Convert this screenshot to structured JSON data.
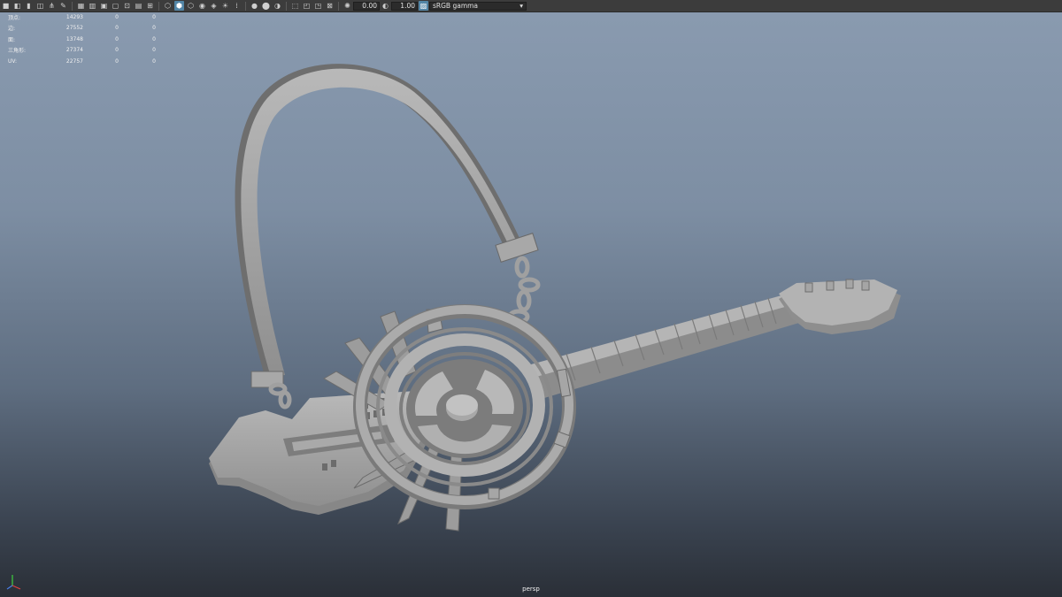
{
  "toolbar": {
    "icons": [
      "camera-icon",
      "camera-attributes-icon",
      "bookmark-icon",
      "image-plane-icon",
      "grid-icon",
      "film-gate-icon",
      "resolution-gate-icon",
      "gate-mask-icon",
      "field-chart-icon",
      "safe-action-icon",
      "safe-title-icon",
      "wireframe-icon",
      "smooth-shade-icon",
      "wireframe-on-shaded-icon",
      "textured-icon",
      "lights-icon",
      "shadows-icon",
      "ambient-occlusion-icon",
      "motion-blur-icon",
      "anti-aliasing-icon",
      "depth-of-field-icon",
      "isolate-select-icon",
      "xray-icon",
      "xray-joints-icon",
      "backface-icon",
      "exposure-icon",
      "gamma-icon"
    ],
    "exposure_value": "0.00",
    "gamma_value": "1.00",
    "color_space": "sRGB gamma"
  },
  "hud": {
    "rows": [
      {
        "label": "顶点:",
        "c1": "14293",
        "c2": "0",
        "c3": "0"
      },
      {
        "label": "边:",
        "c1": "27552",
        "c2": "0",
        "c3": "0"
      },
      {
        "label": "面:",
        "c1": "13748",
        "c2": "0",
        "c3": "0"
      },
      {
        "label": "三角形:",
        "c1": "27374",
        "c2": "0",
        "c3": "0"
      },
      {
        "label": "UV:",
        "c1": "22757",
        "c2": "0",
        "c3": "0"
      }
    ]
  },
  "viewport": {
    "camera": "persp",
    "axis_labels": {
      "x": "",
      "y": "",
      "z": ""
    }
  }
}
